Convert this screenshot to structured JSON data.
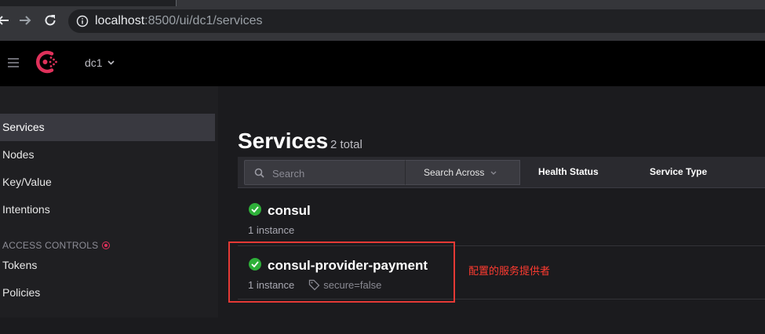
{
  "browser": {
    "url_host": "localhost",
    "url_path": ":8500/ui/dc1/services"
  },
  "header": {
    "datacenter": "dc1"
  },
  "sidebar": {
    "items": [
      {
        "label": "Services"
      },
      {
        "label": "Nodes"
      },
      {
        "label": "Key/Value"
      },
      {
        "label": "Intentions"
      }
    ],
    "section_label": "ACCESS CONTROLS",
    "acl_items": [
      {
        "label": "Tokens"
      },
      {
        "label": "Policies"
      }
    ]
  },
  "main": {
    "title": "Services",
    "count": "2 total",
    "search": {
      "placeholder": "Search"
    },
    "search_across_label": "Search Across",
    "filters": {
      "health_status": "Health Status",
      "service_type": "Service Type"
    },
    "services": [
      {
        "name": "consul",
        "instances": "1 instance",
        "tag": ""
      },
      {
        "name": "consul-provider-payment",
        "instances": "1 instance",
        "tag": "secure=false"
      }
    ]
  },
  "annotation": "配置的服务提供者",
  "colors": {
    "brand": "#e0315b",
    "healthy": "#2eb039",
    "highlight": "#e53935"
  }
}
